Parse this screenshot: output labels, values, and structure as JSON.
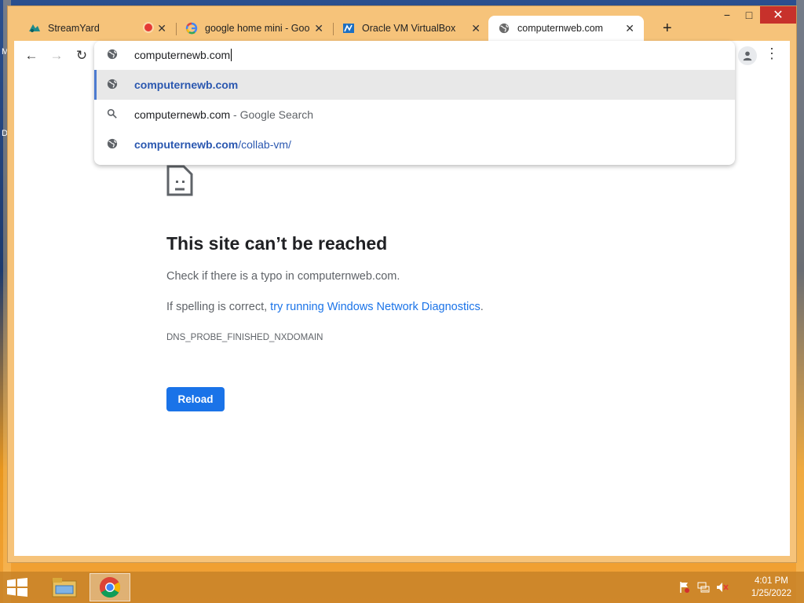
{
  "desktop": {
    "edge_letters": [
      "M",
      "D"
    ]
  },
  "window": {
    "minimize": "−",
    "maximize": "□",
    "close": "✕"
  },
  "tabs": [
    {
      "title": "StreamYard",
      "close": "✕",
      "icon": "streamyard-icon",
      "recording": true
    },
    {
      "title": "google home mini - Goo",
      "close": "✕",
      "icon": "google-icon"
    },
    {
      "title": "Oracle VM VirtualBox",
      "close": "✕",
      "icon": "virtualbox-icon"
    },
    {
      "title": "computernweb.com",
      "close": "✕",
      "icon": "globe-icon",
      "active": true
    }
  ],
  "new_tab": "+",
  "toolbar": {
    "back": "←",
    "forward": "→",
    "reload": "↻",
    "menu": "⋮"
  },
  "omnibox": {
    "input_value": "computernewb.com",
    "suggestions": [
      {
        "icon": "globe-icon",
        "bold": "computernewb.com",
        "rest": "",
        "selected": true
      },
      {
        "icon": "search-icon",
        "plain": "computernewb.com",
        "separator": " - ",
        "source": "Google Search"
      },
      {
        "icon": "globe-icon",
        "bold": "computernewb.com",
        "rest": "/collab-vm/"
      }
    ]
  },
  "error_page": {
    "title": "This site can’t be reached",
    "line1": "Check if there is a typo in computernweb.com.",
    "line2_prefix": "If spelling is correct, ",
    "line2_link": "try running Windows Network Diagnostics",
    "line2_suffix": ".",
    "code": "DNS_PROBE_FINISHED_NXDOMAIN",
    "reload_label": "Reload"
  },
  "taskbar": {
    "apps": [
      "file-explorer-icon",
      "chrome-icon"
    ],
    "tray_icons": [
      "action-center-flag-icon",
      "network-icon",
      "volume-muted-icon"
    ],
    "time": "4:01 PM",
    "date": "1/25/2022"
  },
  "colors": {
    "accent": "#1a73e8",
    "link": "#2b58b0",
    "window_frame": "#f6c37a",
    "close_button": "#c7312b"
  }
}
